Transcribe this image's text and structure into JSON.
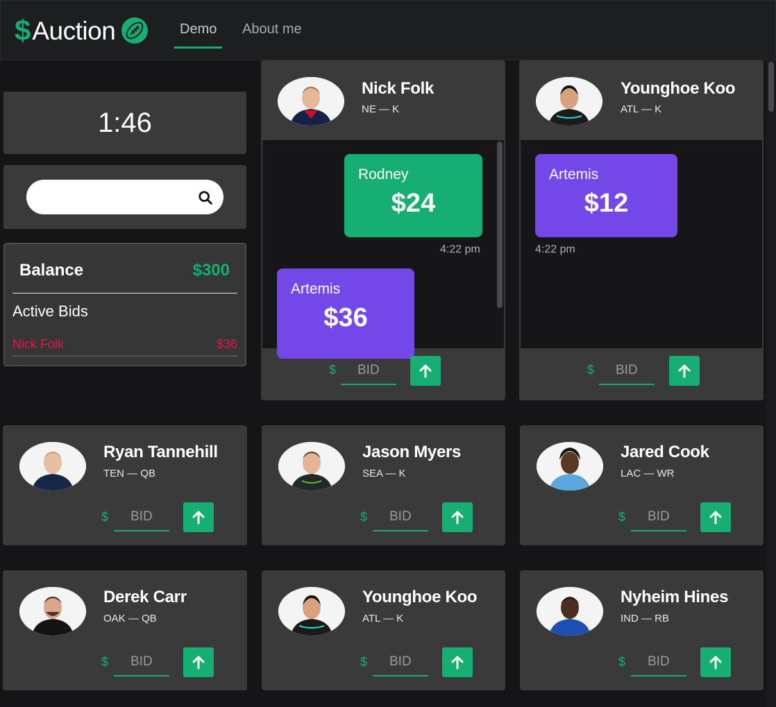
{
  "brand": {
    "dollar": "$",
    "name": "Auction",
    "icon": "football-icon",
    "accent": "#16ae72"
  },
  "nav": {
    "links": [
      {
        "label": "Demo",
        "active": true
      },
      {
        "label": "About me",
        "active": false
      }
    ]
  },
  "timer": "1:46",
  "search": {
    "placeholder": "",
    "value": ""
  },
  "balance": {
    "label": "Balance",
    "value": "$300",
    "active_bids_label": "Active Bids",
    "active_bids": [
      {
        "player": "Nick Folk",
        "amount": "$36"
      }
    ]
  },
  "bid_placeholder": "BID",
  "bid_currency": "$",
  "live_cards": [
    {
      "name": "Nick Folk",
      "team": "NE — K",
      "bids": [
        {
          "bidder": "Rodney",
          "amount": "$24",
          "time": "4:22 pm",
          "color": "#16ae72"
        },
        {
          "bidder": "Artemis",
          "amount": "$36",
          "time": "",
          "color": "#7447e8"
        }
      ]
    },
    {
      "name": "Younghoe Koo",
      "team": "ATL — K",
      "bids": [
        {
          "bidder": "Artemis",
          "amount": "$12",
          "time": "4:22 pm",
          "color": "#7447e8"
        }
      ]
    }
  ],
  "cards": [
    {
      "name": "Ryan Tannehill",
      "team": "TEN — QB"
    },
    {
      "name": "Jason Myers",
      "team": "SEA — K"
    },
    {
      "name": "Jared Cook",
      "team": "LAC — WR"
    },
    {
      "name": "Derek Carr",
      "team": "OAK — QB"
    },
    {
      "name": "Younghoe Koo",
      "team": "ATL — K"
    },
    {
      "name": "Nyheim Hines",
      "team": "IND — RB"
    }
  ]
}
